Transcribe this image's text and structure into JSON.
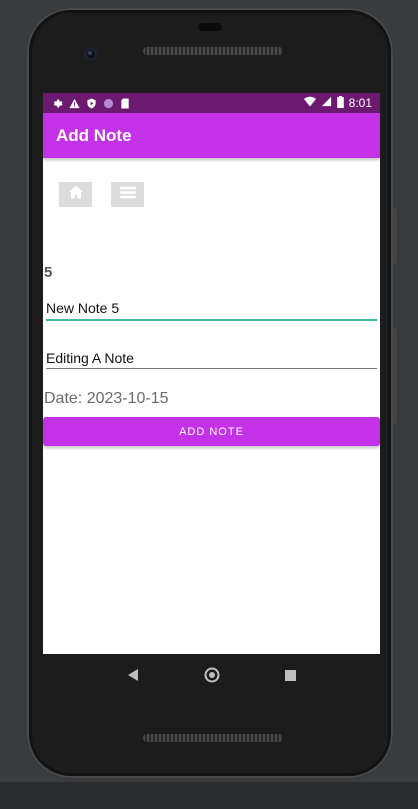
{
  "status_bar": {
    "time": "8:01",
    "left_icons": [
      "settings-icon",
      "warning-icon",
      "play-protect-icon",
      "circle-icon",
      "sd-card-icon"
    ],
    "right_icons": [
      "wifi-icon",
      "signal-icon",
      "battery-icon"
    ]
  },
  "app_bar": {
    "title": "Add Note"
  },
  "toolbar": {
    "icons": [
      "home-icon",
      "list-icon"
    ]
  },
  "form": {
    "note_id": "5",
    "title_value": "New Note 5",
    "description_value": "Editing A Note",
    "date_label": "Date: 2023-10-15",
    "add_button_label": "ADD NOTE"
  },
  "colors": {
    "accent": "#c432e8",
    "status_bar": "#6b1a6f",
    "focus_underline": "#3dbd9d"
  },
  "nav": {
    "icons": [
      "back-icon",
      "home-nav-icon",
      "recents-icon"
    ]
  }
}
